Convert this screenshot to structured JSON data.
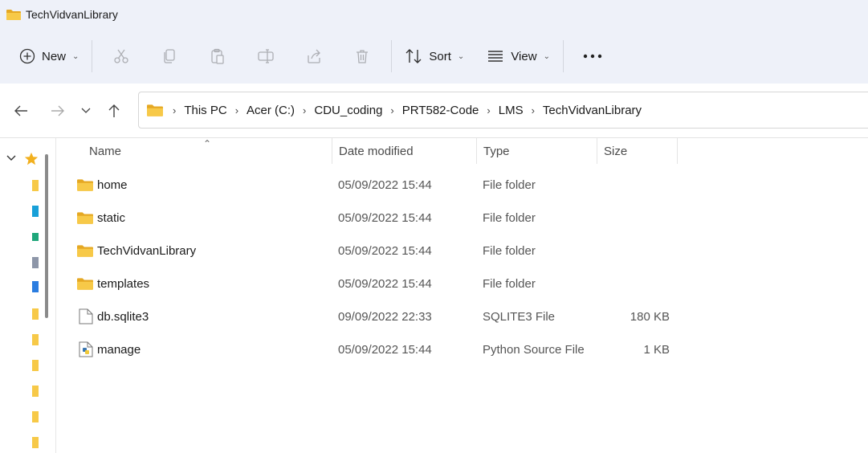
{
  "window": {
    "title": "TechVidvanLibrary"
  },
  "toolbar": {
    "new_label": "New",
    "sort_label": "Sort",
    "view_label": "View"
  },
  "breadcrumb": [
    "This PC",
    "Acer (C:)",
    "CDU_coding",
    "PRT582-Code",
    "LMS",
    "TechVidvanLibrary"
  ],
  "columns": {
    "name": "Name",
    "date": "Date modified",
    "type": "Type",
    "size": "Size"
  },
  "files": [
    {
      "name": "home",
      "date": "05/09/2022 15:44",
      "type": "File folder",
      "size": "",
      "icon": "folder-icon"
    },
    {
      "name": "static",
      "date": "05/09/2022 15:44",
      "type": "File folder",
      "size": "",
      "icon": "folder-icon"
    },
    {
      "name": "TechVidvanLibrary",
      "date": "05/09/2022 15:44",
      "type": "File folder",
      "size": "",
      "icon": "folder-icon"
    },
    {
      "name": "templates",
      "date": "05/09/2022 15:44",
      "type": "File folder",
      "size": "",
      "icon": "folder-icon"
    },
    {
      "name": "db.sqlite3",
      "date": "09/09/2022 22:33",
      "type": "SQLITE3 File",
      "size": "180 KB",
      "icon": "file-icon"
    },
    {
      "name": "manage",
      "date": "05/09/2022 15:44",
      "type": "Python Source File",
      "size": "1 KB",
      "icon": "python-file-icon"
    }
  ],
  "colors": {
    "folder": "#f7c948",
    "folder_dark": "#e5a823",
    "accent": "#0a64c8",
    "chrome": "#eef1f9"
  }
}
